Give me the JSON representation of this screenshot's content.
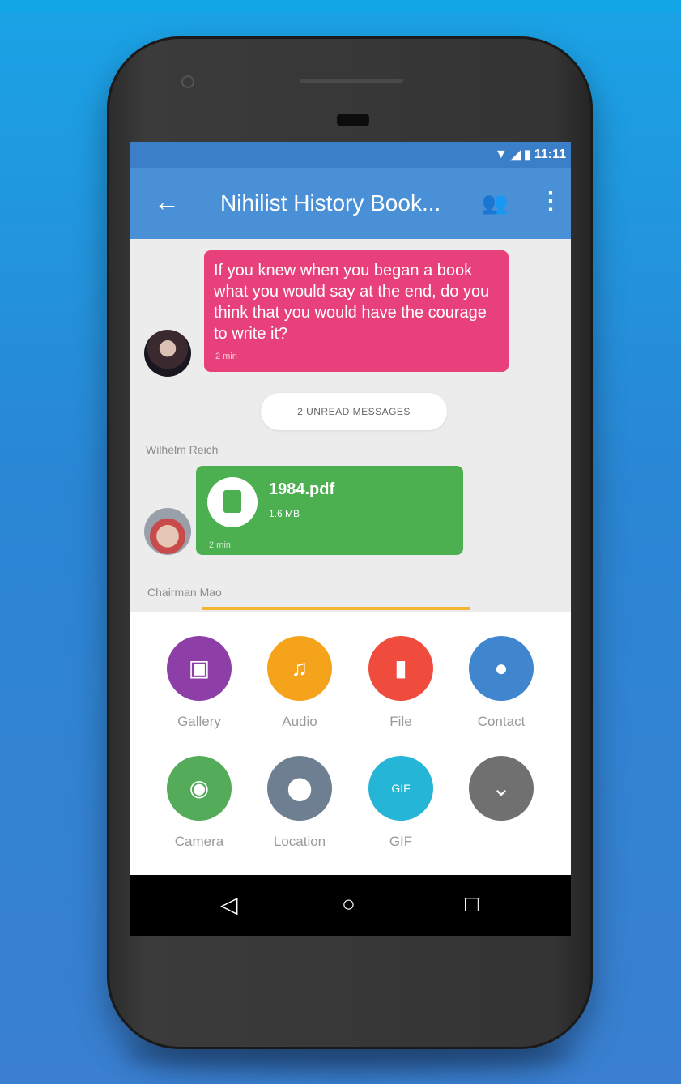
{
  "status_bar": {
    "time": "11:11",
    "wifi_icon": "wifi-icon",
    "signal_icon": "signal-icon",
    "battery_icon": "battery-icon"
  },
  "app_bar": {
    "title": "Nihilist History Book...",
    "back_icon": "arrow-back-icon",
    "group_icon": "group-icon",
    "menu_icon": "more-vert-icon"
  },
  "messages": [
    {
      "type": "text",
      "text": "If you knew when you began a book what you would say at the end, do you think that you would have the courage to write it?",
      "meta": "2 min",
      "color": "#e8407a"
    },
    {
      "type": "file",
      "sender": "Wilhelm Reich",
      "file_name": "1984.pdf",
      "file_size": "1.6 MB",
      "meta": "2 min",
      "color": "#4caf50"
    }
  ],
  "unread_label": "2 UNREAD MESSAGES",
  "next_sender": "Chairman Mao",
  "attachments": [
    {
      "label": "Gallery",
      "icon": "image-icon",
      "color": "#8e3fa7"
    },
    {
      "label": "Audio",
      "icon": "headphones-icon",
      "color": "#f5a31a"
    },
    {
      "label": "File",
      "icon": "file-icon",
      "color": "#ef4c3d"
    },
    {
      "label": "Contact",
      "icon": "person-icon",
      "color": "#3f86cf"
    },
    {
      "label": "Camera",
      "icon": "camera-icon",
      "color": "#54ab5a"
    },
    {
      "label": "Location",
      "icon": "location-icon",
      "color": "#6f7f92"
    },
    {
      "label": "GIF",
      "icon": "gif-icon",
      "color": "#25b5d6"
    },
    {
      "label": "",
      "icon": "chevron-down-icon",
      "color": "#707070"
    }
  ],
  "nav": {
    "back_icon": "nav-back-icon",
    "home_icon": "nav-home-icon",
    "recents_icon": "nav-recents-icon"
  }
}
